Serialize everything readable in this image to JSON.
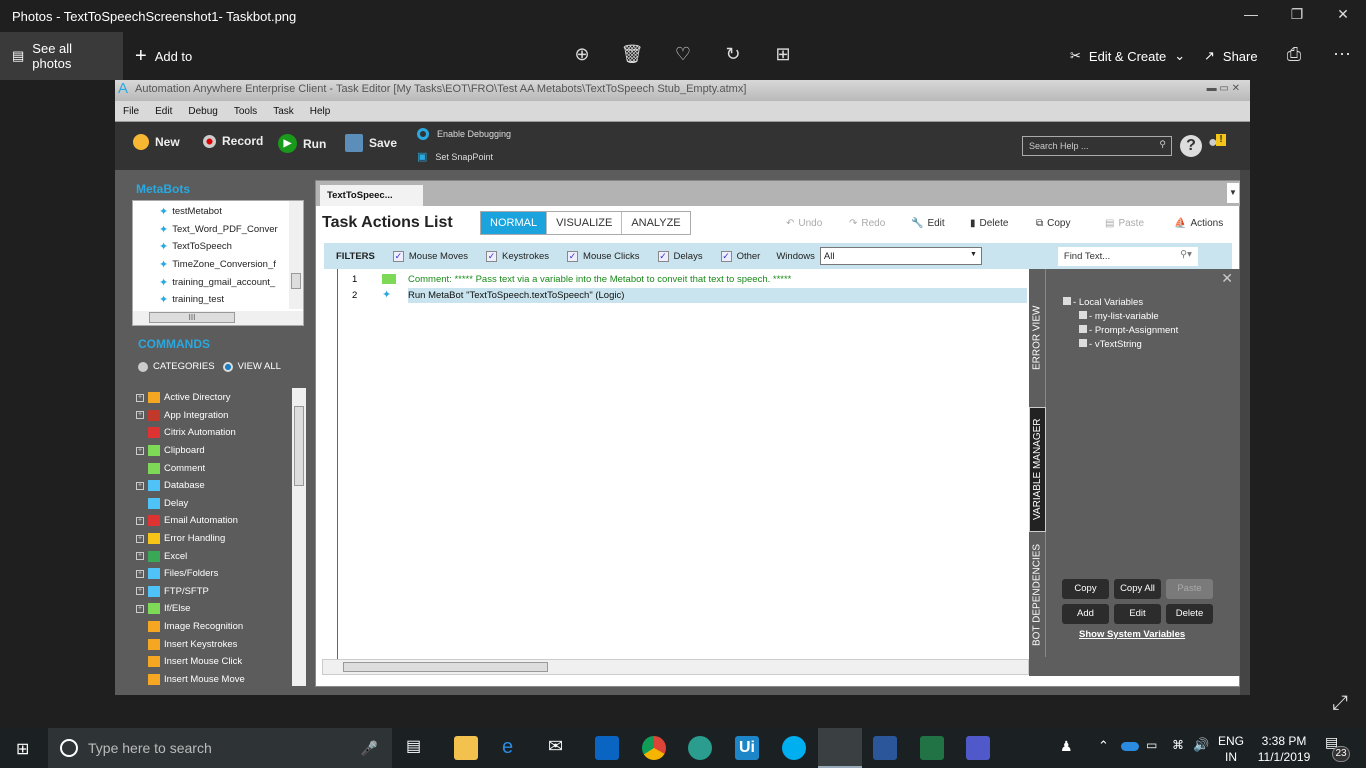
{
  "photos": {
    "title": "Photos - TextToSpeechScreenshot1- Taskbot.png",
    "see_all": "See all photos",
    "add_to": "Add to",
    "edit_create": "Edit & Create",
    "share": "Share"
  },
  "aa": {
    "title": "Automation Anywhere Enterprise Client - Task Editor [My Tasks\\EOT\\FRO\\Test AA Metabots\\TextToSpeech Stub_Empty.atmx]",
    "menu": [
      "File",
      "Edit",
      "Debug",
      "Tools",
      "Task",
      "Help"
    ],
    "toolbar": {
      "new": "New",
      "record": "Record",
      "run": "Run",
      "save": "Save",
      "enable_debugging": "Enable Debugging",
      "set_snappoint": "Set SnapPoint",
      "search_placeholder": "Search Help ..."
    },
    "metabots": {
      "heading": "MetaBots",
      "items": [
        "testMetabot",
        "Text_Word_PDF_Conver",
        "TextToSpeech",
        "TimeZone_Conversion_f",
        "training_gmail_account_",
        "training_test"
      ],
      "hscroll": "III"
    },
    "commands": {
      "heading": "COMMANDS",
      "categories": "CATEGORIES",
      "view_all": "VIEW ALL",
      "items": [
        {
          "label": "Active Directory",
          "color": "#f5a623",
          "exp": true
        },
        {
          "label": "App Integration",
          "color": "#c0392b",
          "exp": true
        },
        {
          "label": "Citrix Automation",
          "color": "#d33",
          "exp": false
        },
        {
          "label": "Clipboard",
          "color": "#7ed957",
          "exp": true
        },
        {
          "label": "Comment",
          "color": "#7ed957",
          "exp": false
        },
        {
          "label": "Database",
          "color": "#4fc3f7",
          "exp": true
        },
        {
          "label": "Delay",
          "color": "#4fc3f7",
          "exp": false
        },
        {
          "label": "Email Automation",
          "color": "#d33",
          "exp": true
        },
        {
          "label": "Error Handling",
          "color": "#f5c518",
          "exp": true
        },
        {
          "label": "Excel",
          "color": "#3aa757",
          "exp": true
        },
        {
          "label": "Files/Folders",
          "color": "#4fc3f7",
          "exp": true
        },
        {
          "label": "FTP/SFTP",
          "color": "#4fc3f7",
          "exp": true
        },
        {
          "label": "If/Else",
          "color": "#7ed957",
          "exp": true
        },
        {
          "label": "Image Recognition",
          "color": "#f5a623",
          "exp": false
        },
        {
          "label": "Insert Keystrokes",
          "color": "#f5a623",
          "exp": false
        },
        {
          "label": "Insert Mouse Click",
          "color": "#f5a623",
          "exp": false
        },
        {
          "label": "Insert Mouse Move",
          "color": "#f5a623",
          "exp": false
        }
      ]
    },
    "tab": "TextToSpeec...",
    "task_actions": {
      "heading": "Task Actions List",
      "modes": [
        "NORMAL",
        "VISUALIZE",
        "ANALYZE"
      ],
      "undo": "Undo",
      "redo": "Redo",
      "edit": "Edit",
      "delete": "Delete",
      "copy": "Copy",
      "paste": "Paste",
      "actions": "Actions"
    },
    "filters": {
      "label": "FILTERS",
      "items": [
        "Mouse Moves",
        "Keystrokes",
        "Mouse Clicks",
        "Delays",
        "Other"
      ],
      "windows_label": "Windows",
      "windows_value": "All",
      "find_placeholder": "Find Text..."
    },
    "rows": [
      {
        "n": "1",
        "text": "Comment: ***** Pass text via a variable into the Metabot to conveit that text to speech. *****"
      },
      {
        "n": "2",
        "text": "Run MetaBot \"TextToSpeech.textToSpeech\" (Logic)"
      }
    ],
    "side_tabs": {
      "error": "ERROR VIEW",
      "vars": "VARIABLE MANAGER",
      "deps": "BOT DEPENDENCIES"
    },
    "variables": {
      "root": "Local Variables",
      "items": [
        "my-list-variable",
        "Prompt-Assignment",
        "vTextString"
      ],
      "buttons": [
        "Copy",
        "Copy All",
        "Paste",
        "Add",
        "Edit",
        "Delete"
      ],
      "show_system": "Show System Variables"
    }
  },
  "taskbar": {
    "search": "Type here to search",
    "lang1": "ENG",
    "lang2": "IN",
    "time": "3:38 PM",
    "date": "11/1/2019",
    "notif": "23"
  }
}
